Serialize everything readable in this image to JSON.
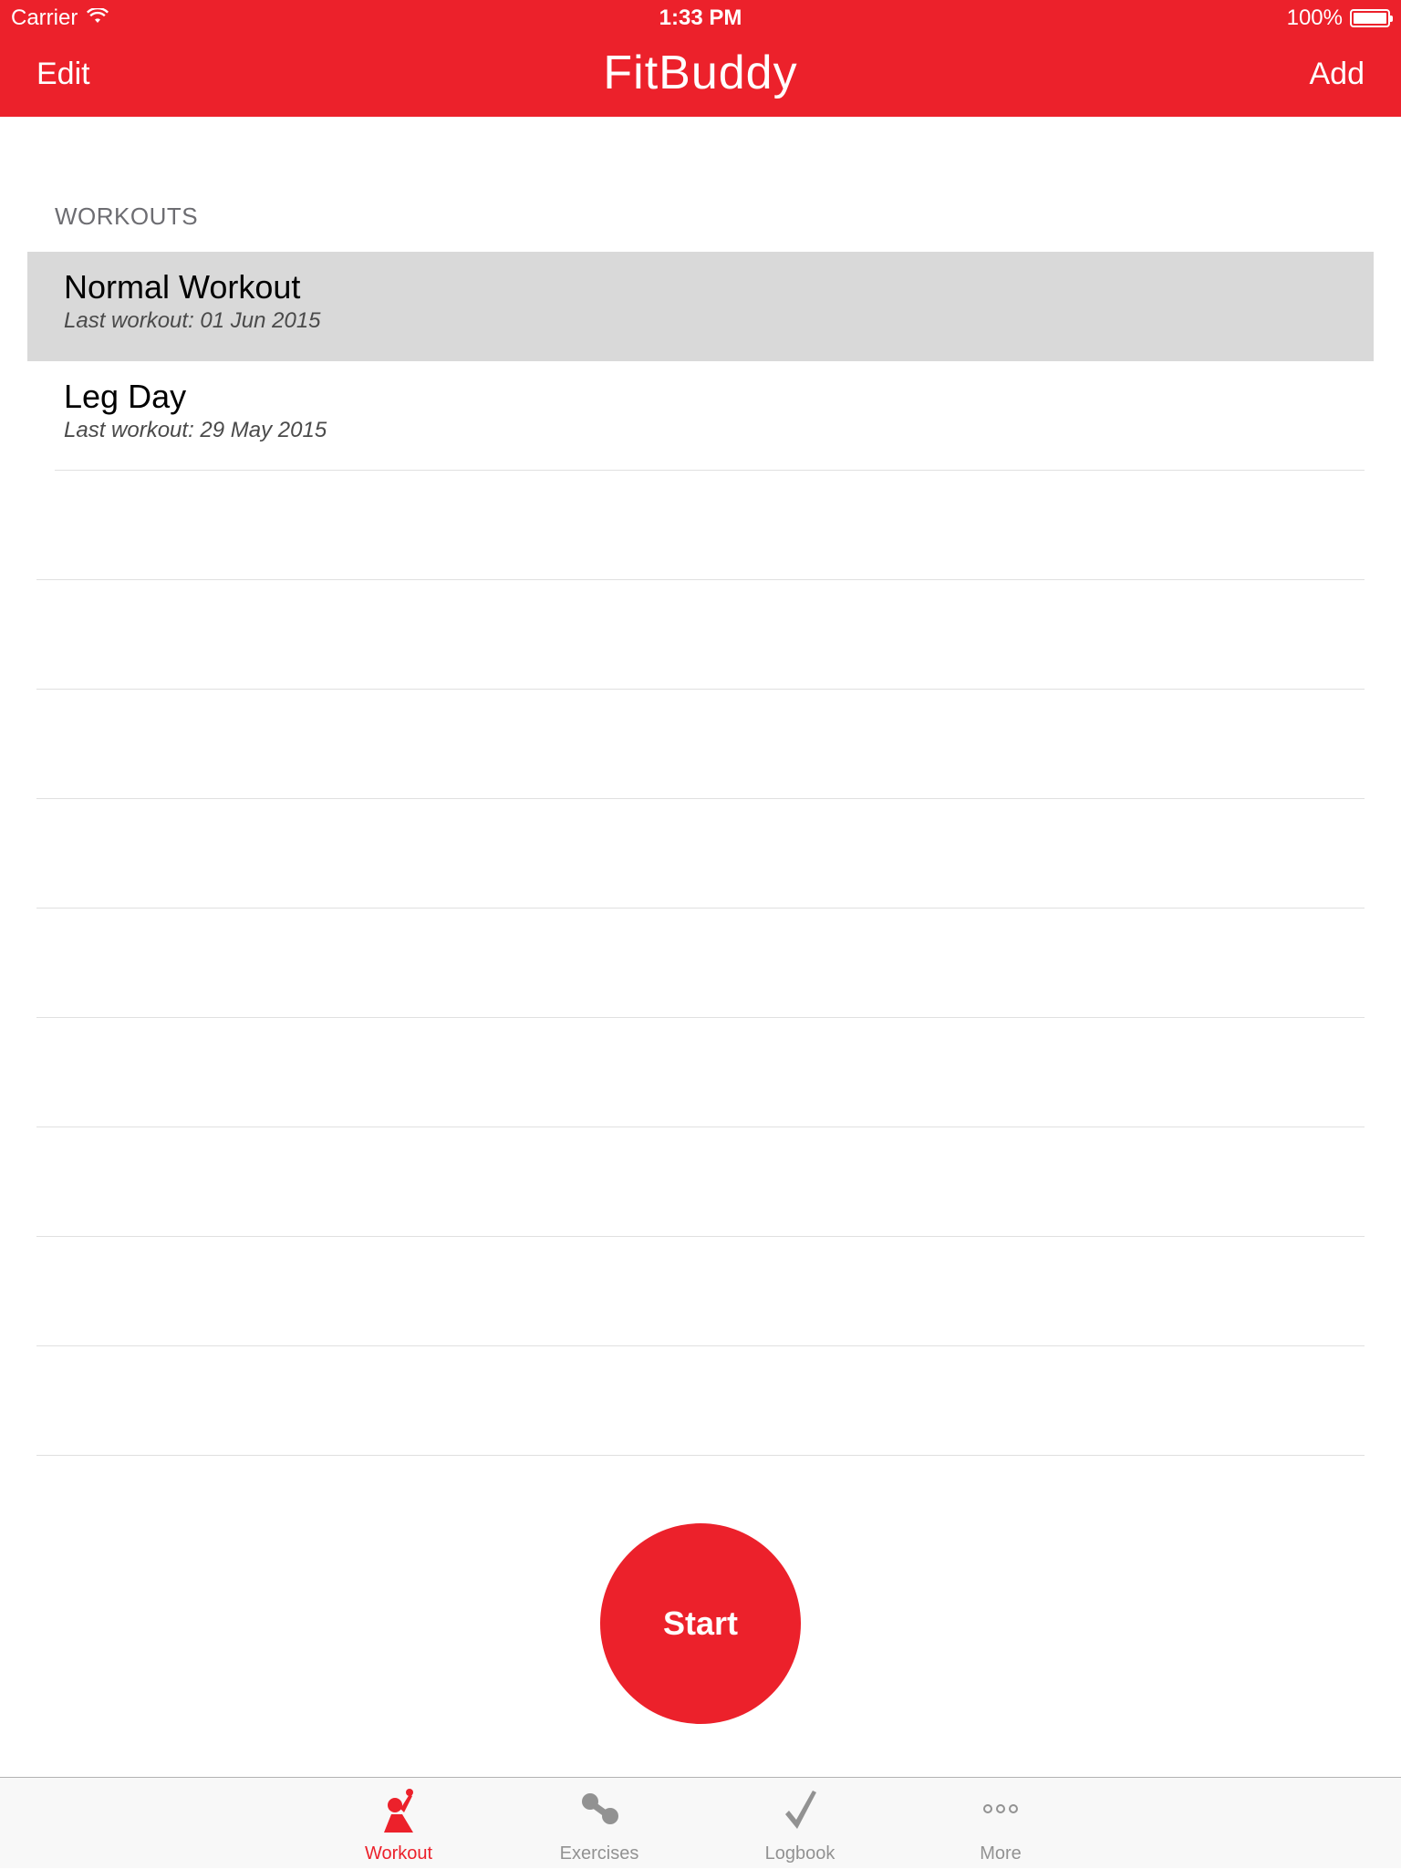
{
  "status_bar": {
    "carrier": "Carrier",
    "time": "1:33 PM",
    "battery": "100%",
    "battery_level": 1.0
  },
  "nav_bar": {
    "left_button": "Edit",
    "title": "FitBuddy",
    "right_button": "Add"
  },
  "section": {
    "header": "WORKOUTS"
  },
  "workouts": [
    {
      "name": "Normal Workout",
      "last_workout": "Last workout:  01 Jun 2015",
      "selected": true
    },
    {
      "name": "Leg Day",
      "last_workout": "Last workout:  29 May 2015",
      "selected": false
    }
  ],
  "start_button": "Start",
  "tab_bar": {
    "tabs": [
      {
        "label": "Workout",
        "icon": "workout-icon",
        "active": true
      },
      {
        "label": "Exercises",
        "icon": "exercises-icon",
        "active": false
      },
      {
        "label": "Logbook",
        "icon": "logbook-icon",
        "active": false
      },
      {
        "label": "More",
        "icon": "more-icon",
        "active": false
      }
    ]
  },
  "colors": {
    "accent": "#ec212b",
    "selected_row": "#d9d9d9",
    "section_header": "#6d6d72",
    "tab_inactive": "#929292"
  }
}
